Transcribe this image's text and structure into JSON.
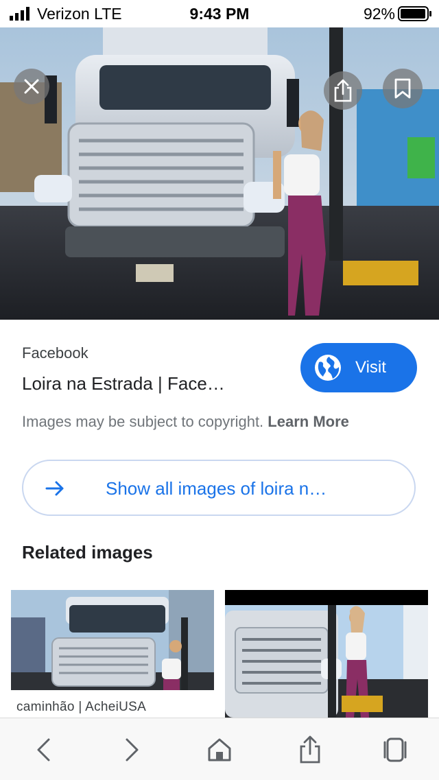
{
  "status_bar": {
    "carrier": "Verizon  LTE",
    "time": "9:43 PM",
    "battery": "92%"
  },
  "hero": {
    "close_icon": "close-icon",
    "share_icon": "share-icon",
    "bookmark_icon": "bookmark-icon"
  },
  "result": {
    "source": "Facebook",
    "title": "Loira na Estrada | Face…",
    "visit_label": "Visit",
    "visit_icon": "globe-icon",
    "copyright_text": "Images may be subject to copyright.",
    "learn_more": "Learn More"
  },
  "show_all": {
    "label": "Show all images of loira n…",
    "icon": "arrow-right-icon"
  },
  "related": {
    "heading": "Related images",
    "items": [
      {
        "caption": "caminhão | AcheiUSA"
      },
      {
        "caption": ""
      }
    ]
  },
  "toolbar": {
    "icons": [
      "back-icon",
      "forward-icon",
      "home-icon",
      "share-icon",
      "tabs-icon"
    ]
  },
  "colors": {
    "accent": "#1a73e8",
    "text": "#202124",
    "muted": "#70757a"
  }
}
